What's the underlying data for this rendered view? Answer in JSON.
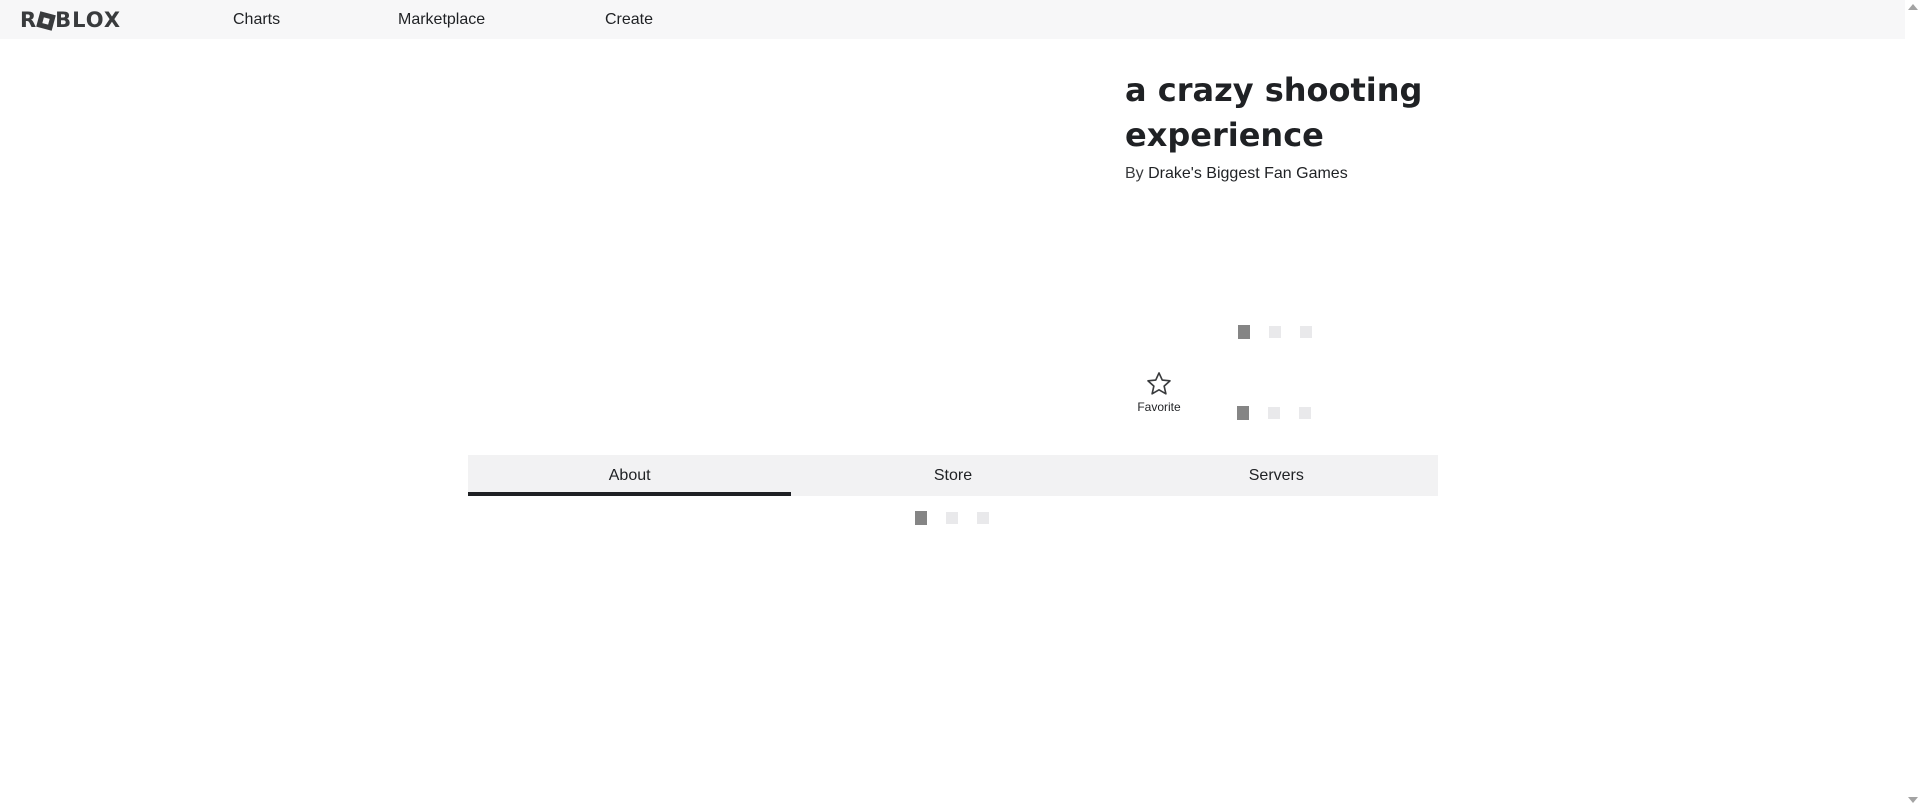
{
  "app": {
    "logo_text_prefix": "R",
    "logo_text_suffix": "BLOX"
  },
  "nav": {
    "items": [
      {
        "label": "Charts"
      },
      {
        "label": "Marketplace"
      },
      {
        "label": "Create"
      }
    ]
  },
  "game": {
    "title": "a crazy shooting experience",
    "by_prefix": "By",
    "creator": "Drake's Biggest Fan Games"
  },
  "favorite": {
    "label": "Favorite",
    "icon": "star-outline-icon"
  },
  "tabs": [
    {
      "label": "About",
      "active": true
    },
    {
      "label": "Store",
      "active": false
    },
    {
      "label": "Servers",
      "active": false
    }
  ],
  "colors": {
    "topbar_bg": "#f7f7f8",
    "text": "#1f2124",
    "tab_bg": "#f2f2f3",
    "loader_active": "#858585",
    "loader_inactive": "#e9e9eb"
  }
}
